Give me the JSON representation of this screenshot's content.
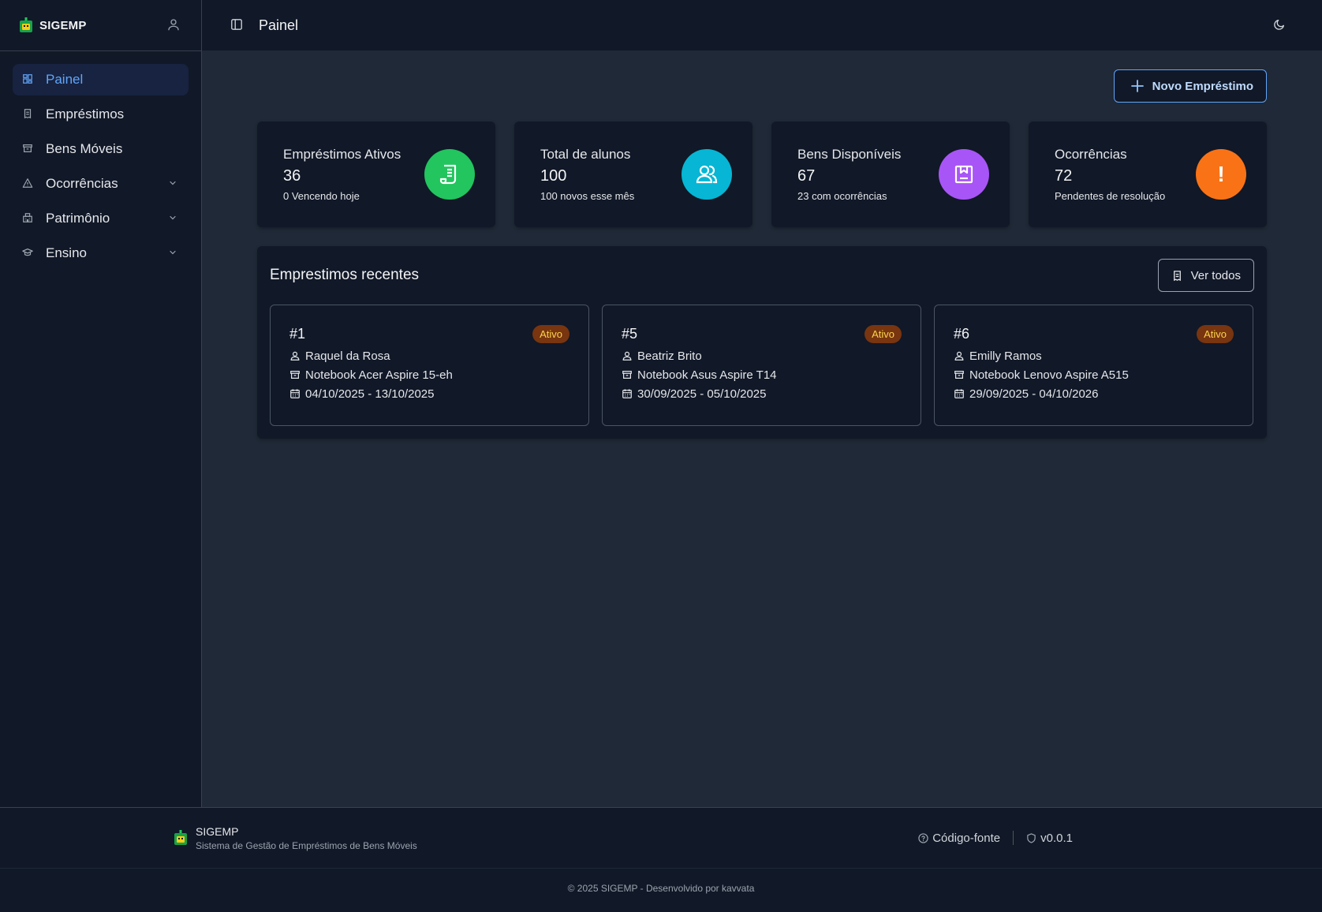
{
  "app": {
    "name": "SIGEMP"
  },
  "sidebar": {
    "items": [
      {
        "label": "Painel",
        "icon": "dashboard-icon",
        "active": true
      },
      {
        "label": "Empréstimos",
        "icon": "receipt-icon"
      },
      {
        "label": "Bens Móveis",
        "icon": "archive-icon"
      },
      {
        "label": "Ocorrências",
        "icon": "warning-icon",
        "expandable": true
      },
      {
        "label": "Patrimônio",
        "icon": "building-icon",
        "expandable": true
      },
      {
        "label": "Ensino",
        "icon": "graduation-cap-icon",
        "expandable": true
      }
    ]
  },
  "header": {
    "title": "Painel"
  },
  "actions": {
    "new_loan_label": "Novo Empréstimo"
  },
  "stats": [
    {
      "label": "Empréstimos Ativos",
      "value": "36",
      "sub": "0 Vencendo hoje",
      "color": "#22c55e",
      "icon": "receipt-icon"
    },
    {
      "label": "Total de alunos",
      "value": "100",
      "sub": "100 novos esse mês",
      "color": "#06b6d4",
      "icon": "users-icon"
    },
    {
      "label": "Bens Disponíveis",
      "value": "67",
      "sub": "23 com ocorrências",
      "color": "#a855f7",
      "icon": "package-icon"
    },
    {
      "label": "Ocorrências",
      "value": "72",
      "sub": "Pendentes de resolução",
      "color": "#f97316",
      "icon": "!"
    }
  ],
  "recent": {
    "title": "Emprestimos recentes",
    "view_all_label": "Ver todos",
    "loans": [
      {
        "id": "#1",
        "status": "Ativo",
        "person": "Raquel da Rosa",
        "item": "Notebook Acer Aspire 15-eh",
        "dates": "04/10/2025 - 13/10/2025"
      },
      {
        "id": "#5",
        "status": "Ativo",
        "person": "Beatriz Brito",
        "item": "Notebook Asus Aspire T14",
        "dates": "30/09/2025 - 05/10/2025"
      },
      {
        "id": "#6",
        "status": "Ativo",
        "person": "Emilly Ramos",
        "item": "Notebook Lenovo Aspire A515",
        "dates": "29/09/2025 - 04/10/2026"
      }
    ]
  },
  "footer": {
    "name": "SIGEMP",
    "description": "Sistema de Gestão de Empréstimos de Bens Móveis",
    "source_label": "Código-fonte",
    "version": "v0.0.1",
    "copyright": "© 2025 SIGEMP - Desenvolvido por kavvata"
  },
  "colors": {
    "accent": "#60a5fa",
    "badge_bg": "#78350f",
    "badge_text": "#fcd34d"
  }
}
